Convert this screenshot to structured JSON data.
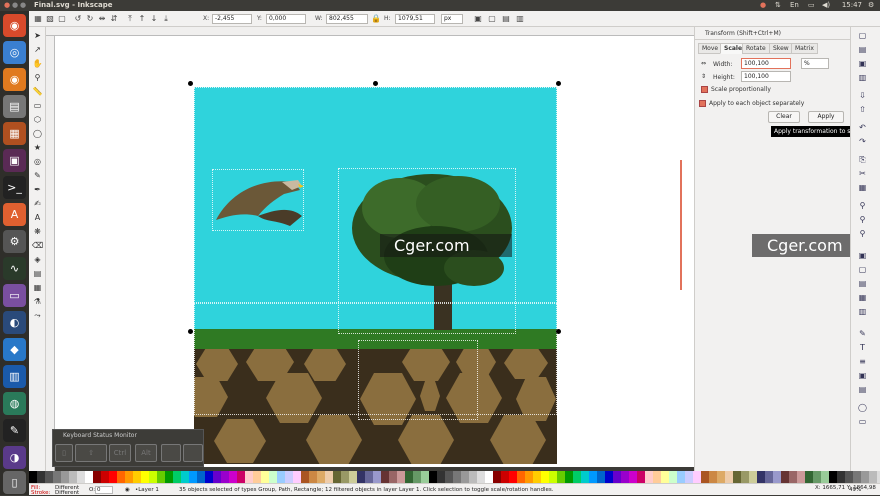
{
  "window": {
    "title": "Final.svg - Inkscape",
    "clock": "15:47",
    "lang": "En"
  },
  "controls": {
    "x_label": "X:",
    "x_value": "-2,455",
    "y_label": "Y:",
    "y_value": "0,000",
    "w_label": "W:",
    "w_value": "802,455",
    "h_label": "H:",
    "h_value": "1079,51",
    "unit": "px"
  },
  "panel": {
    "title": "Transform (Shift+Ctrl+M)",
    "tabs": [
      "Move",
      "Scale",
      "Rotate",
      "Skew",
      "Matrix"
    ],
    "active_tab": "Scale",
    "width_label": "Width:",
    "width_value": "100,100",
    "height_label": "Height:",
    "height_value": "100,100",
    "unit": "%",
    "scale_prop": "Scale proportionally",
    "apply_each": "Apply to each object separately",
    "clear": "Clear",
    "apply": "Apply",
    "tooltip": "Apply transformation to selection"
  },
  "watermark": "Cger.com",
  "keyboard_monitor": {
    "title": "Keyboard Status Monitor",
    "keys": [
      "Ctrl",
      "Alt"
    ]
  },
  "status": {
    "fill_label": "Fill:",
    "fill_value": "Different",
    "stroke_label": "Stroke:",
    "stroke_value": "Different",
    "opacity_label": "O:",
    "opacity_value": "0",
    "layer": "•Layer 1",
    "message": "35 objects selected of types Group, Path, Rectangle; 12 filtered objects in layer Layer 1. Click selection to toggle scale/rotation handles.",
    "coords": "X: 1665,71  Y: 1864,98",
    "zoom": "49%"
  },
  "colors": {
    "sky": "#2fd3dc",
    "grass": "#2f7a23",
    "accent": "#e2725b"
  }
}
